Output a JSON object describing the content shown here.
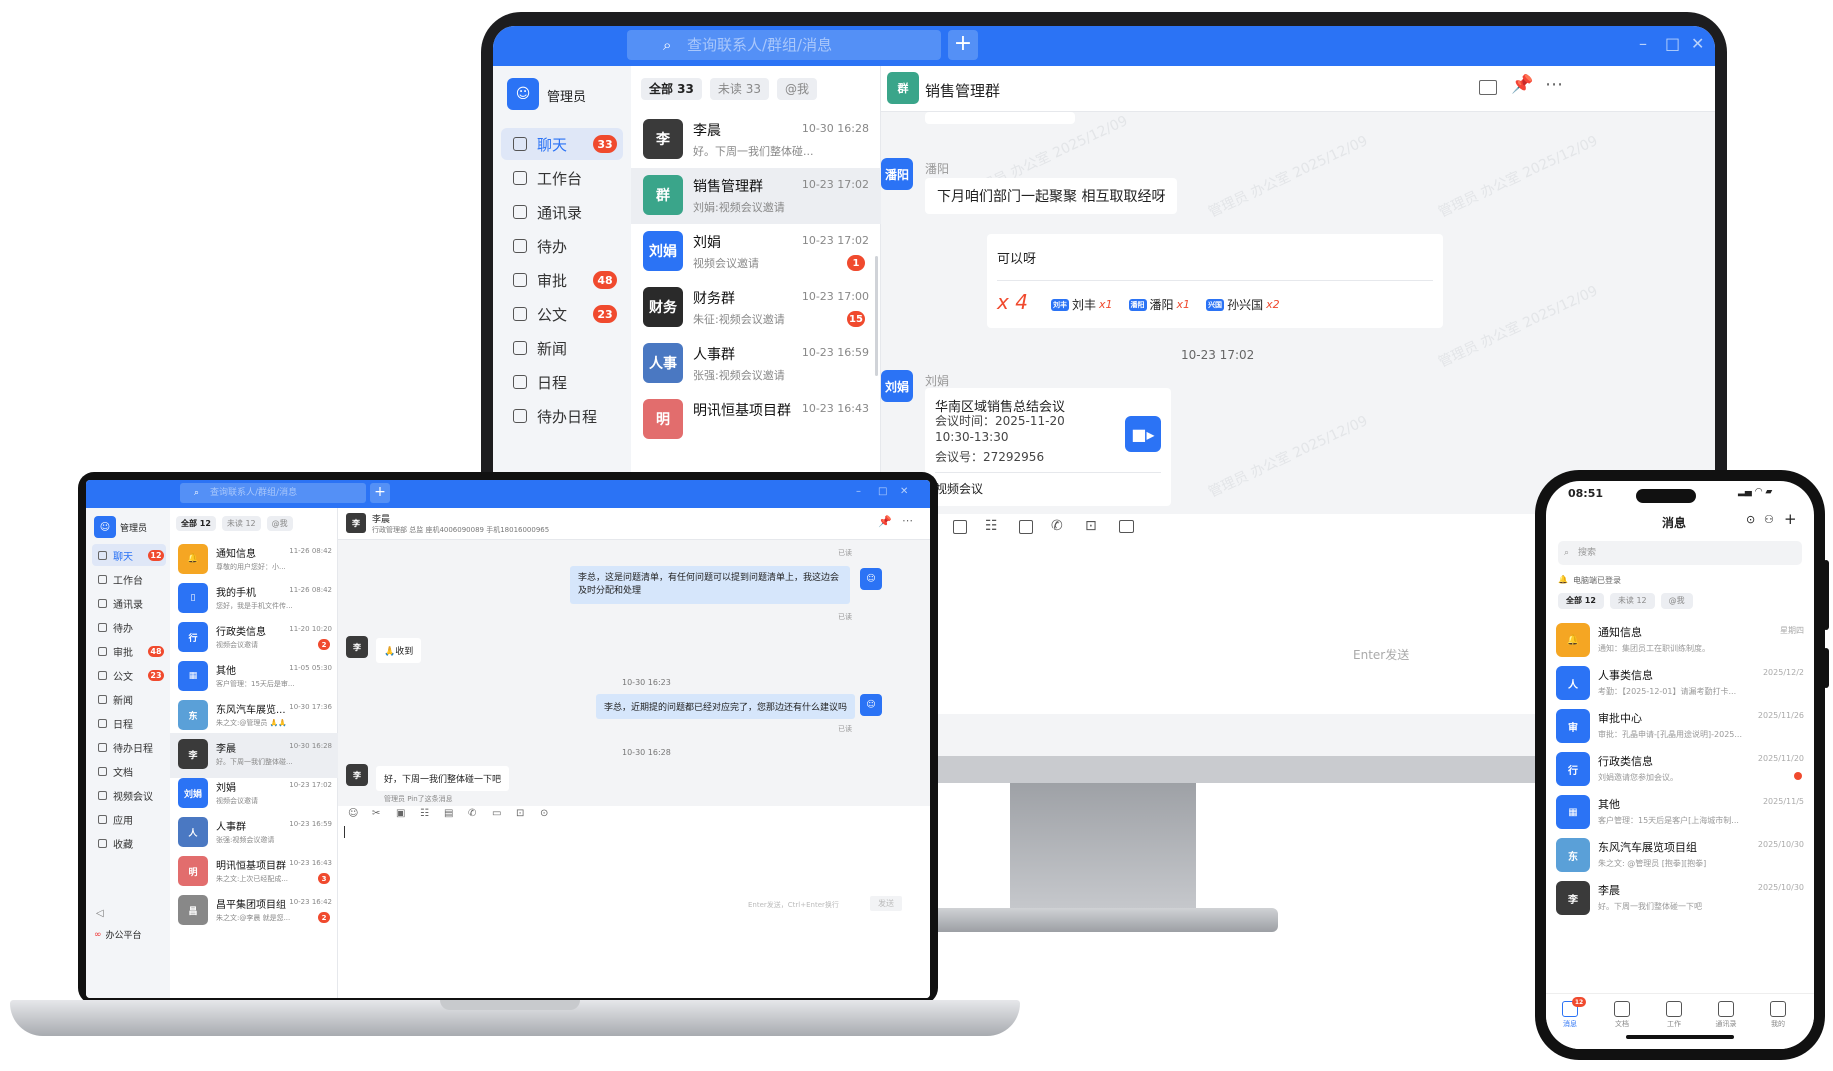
{
  "monitor": {
    "search_placeholder": "查询联系人/群组/消息",
    "plus": "+",
    "window_controls": [
      "–",
      "□",
      "✕"
    ],
    "user": "管理员",
    "nav": [
      {
        "label": "聊天",
        "badge": "33",
        "active": true
      },
      {
        "label": "工作台",
        "badge": ""
      },
      {
        "label": "通讯录",
        "badge": ""
      },
      {
        "label": "待办",
        "badge": ""
      },
      {
        "label": "审批",
        "badge": "48"
      },
      {
        "label": "公文",
        "badge": "23"
      },
      {
        "label": "新闻",
        "badge": ""
      },
      {
        "label": "日程",
        "badge": ""
      },
      {
        "label": "待办日程",
        "badge": ""
      }
    ],
    "tabs": [
      "全部 33",
      "未读 33",
      "@我"
    ],
    "conversations": [
      {
        "name": "李晨",
        "time": "10-30 16:28",
        "preview": "好。下周一我们整体碰...",
        "avatar": "李",
        "color": "#3a3a3a",
        "badge": ""
      },
      {
        "name": "销售管理群",
        "time": "10-23 17:02",
        "preview": "刘娟:视频会议邀请",
        "avatar": "群",
        "color": "#3aa58a",
        "badge": "",
        "selected": true
      },
      {
        "name": "刘娟",
        "time": "10-23 17:02",
        "preview": "视频会议邀请",
        "avatar": "刘娟",
        "color": "#2b73f5",
        "badge": "1"
      },
      {
        "name": "财务群",
        "time": "10-23 17:00",
        "preview": "朱征:视频会议邀请",
        "avatar": "财务",
        "color": "#2a2a2a",
        "badge": "15"
      },
      {
        "name": "人事群",
        "time": "10-23 16:59",
        "preview": "张强:视频会议邀请",
        "avatar": "人事",
        "color": "#4a78c2",
        "badge": ""
      },
      {
        "name": "明讯恒基项目群",
        "time": "10-23 16:43",
        "preview": "",
        "avatar": "明",
        "color": "#e26d6d",
        "badge": ""
      }
    ],
    "chat": {
      "title": "销售管理群",
      "msg1_sender": "潘阳",
      "msg1_avatar": "潘阳",
      "msg1_text": "下月咱们部门一起聚聚 相互取取经呀",
      "reply_text": "可以呀",
      "reaction_count": "x 4",
      "reactions": [
        {
          "tag": "刘丰",
          "name": "刘丰",
          "count": "x1"
        },
        {
          "tag": "潘阳",
          "name": "潘阳",
          "count": "x1"
        },
        {
          "tag": "兴国",
          "name": "孙兴国",
          "count": "x2"
        }
      ],
      "time_divider": "10-23 17:02",
      "msg2_sender": "刘娟",
      "msg2_avatar": "刘娟",
      "meeting_title": "华南区域销售总结会议",
      "meeting_time": "会议时间：2025-11-20 10:30-13:30",
      "meeting_id": "会议号：27292956",
      "meeting_footer": "视频会议",
      "send_hint": "Enter发送",
      "watermark": "管理员 办公室 2025/12/09"
    }
  },
  "laptop": {
    "search_placeholder": "查询联系人/群组/消息",
    "user": "管理员",
    "nav": [
      {
        "label": "聊天",
        "badge": "12",
        "active": true
      },
      {
        "label": "工作台",
        "badge": ""
      },
      {
        "label": "通讯录",
        "badge": ""
      },
      {
        "label": "待办",
        "badge": ""
      },
      {
        "label": "审批",
        "badge": "48"
      },
      {
        "label": "公文",
        "badge": "23"
      },
      {
        "label": "新闻",
        "badge": ""
      },
      {
        "label": "日程",
        "badge": ""
      },
      {
        "label": "待办日程",
        "badge": ""
      },
      {
        "label": "文档",
        "badge": ""
      },
      {
        "label": "视频会议",
        "badge": ""
      },
      {
        "label": "应用",
        "badge": ""
      },
      {
        "label": "收藏",
        "badge": ""
      }
    ],
    "platform": "办公平台",
    "tabs": [
      "全部 12",
      "未读 12",
      "@我"
    ],
    "conversations": [
      {
        "name": "通知信息",
        "time": "11-26 08:42",
        "preview": "尊敬的用户您好：小...",
        "avatar": "🔔",
        "color": "#f5a623",
        "badge": ""
      },
      {
        "name": "我的手机",
        "time": "11-26 08:42",
        "preview": "您好，我是手机文件传...",
        "avatar": "▯",
        "color": "#2b73f5",
        "badge": ""
      },
      {
        "name": "行政类信息",
        "time": "11-20 10:20",
        "preview": "视频会议邀请",
        "avatar": "行",
        "color": "#2b73f5",
        "badge": "2"
      },
      {
        "name": "其他",
        "time": "11-05 05:30",
        "preview": "客户管理：15天后是审...",
        "avatar": "▦",
        "color": "#2b73f5",
        "badge": ""
      },
      {
        "name": "东风汽车展览...",
        "time": "10-30 17:36",
        "preview": "朱之文:@管理员 🙏🙏",
        "avatar": "东",
        "color": "#5aa0d8",
        "badge": ""
      },
      {
        "name": "李晨",
        "time": "10-30 16:28",
        "preview": "好。下周一我们整体碰...",
        "avatar": "李",
        "color": "#3a3a3a",
        "badge": "",
        "selected": true
      },
      {
        "name": "刘娟",
        "time": "10-23 17:02",
        "preview": "视频会议邀请",
        "avatar": "刘娟",
        "color": "#2b73f5",
        "badge": ""
      },
      {
        "name": "人事群",
        "time": "10-23 16:59",
        "preview": "张强:视频会议邀请",
        "avatar": "人",
        "color": "#4a78c2",
        "badge": ""
      },
      {
        "name": "明讯恒基项目群",
        "time": "10-23 16:43",
        "preview": "朱之文:上次已经配成...",
        "avatar": "明",
        "color": "#e26d6d",
        "badge": "3"
      },
      {
        "name": "昌平集团项目组",
        "time": "10-23 16:42",
        "preview": "朱之文:@李晨 就是您...",
        "avatar": "昌",
        "color": "#888",
        "badge": "2"
      }
    ],
    "chat": {
      "name": "李晨",
      "info": "行政管理部 总监 座机4006090089 手机18016000965",
      "read": "已读",
      "msg1": "李总，这是问题清单，有任何问题可以提到问题清单上，我这边会及时分配和处理",
      "msg2": "🙏收到",
      "time1": "10-30 16:23",
      "msg3": "李总，近期提的问题都已经对应完了，您那边还有什么建议吗",
      "time2": "10-30 16:28",
      "msg4": "好，下周一我们整体碰一下吧",
      "pin_note": "管理员 Pin了这条消息",
      "send_hint": "Enter发送，Ctrl+Enter换行",
      "send": "发送"
    }
  },
  "phone": {
    "clock": "08:51",
    "title": "消息",
    "search": "搜索",
    "pc_status": "电脑端已登录",
    "tabs": [
      "全部 12",
      "未读 12",
      "@我"
    ],
    "conversations": [
      {
        "name": "通知信息",
        "time": "星期四",
        "preview": "通知：集团员工在职训练制度。",
        "avatar": "🔔",
        "color": "#f5a623"
      },
      {
        "name": "人事类信息",
        "time": "2025/12/2",
        "preview": "考勤：【2025-12-01】请漏考勤打卡...",
        "avatar": "人",
        "color": "#2b73f5"
      },
      {
        "name": "审批中心",
        "time": "2025/11/26",
        "preview": "审批：孔晶申请-[孔晶用途说明]-2025...",
        "avatar": "审",
        "color": "#2b73f5"
      },
      {
        "name": "行政类信息",
        "time": "2025/11/20",
        "preview": "刘娟邀请您参加会议。",
        "avatar": "行",
        "color": "#2b73f5",
        "dot": true
      },
      {
        "name": "其他",
        "time": "2025/11/5",
        "preview": "客户管理：15天后是客户[上海城市制...",
        "avatar": "▦",
        "color": "#2b73f5"
      },
      {
        "name": "东风汽车展览项目组",
        "time": "2025/10/30",
        "preview": "朱之文: @管理员 [抱拳][抱拳]",
        "avatar": "东",
        "color": "#5aa0d8"
      },
      {
        "name": "李晨",
        "time": "2025/10/30",
        "preview": "好。下周一我们整体碰一下吧",
        "avatar": "李",
        "color": "#3a3a3a"
      }
    ],
    "tabbar": [
      {
        "label": "消息",
        "badge": "12"
      },
      {
        "label": "文档"
      },
      {
        "label": "工作"
      },
      {
        "label": "通讯录"
      },
      {
        "label": "我的"
      }
    ]
  }
}
